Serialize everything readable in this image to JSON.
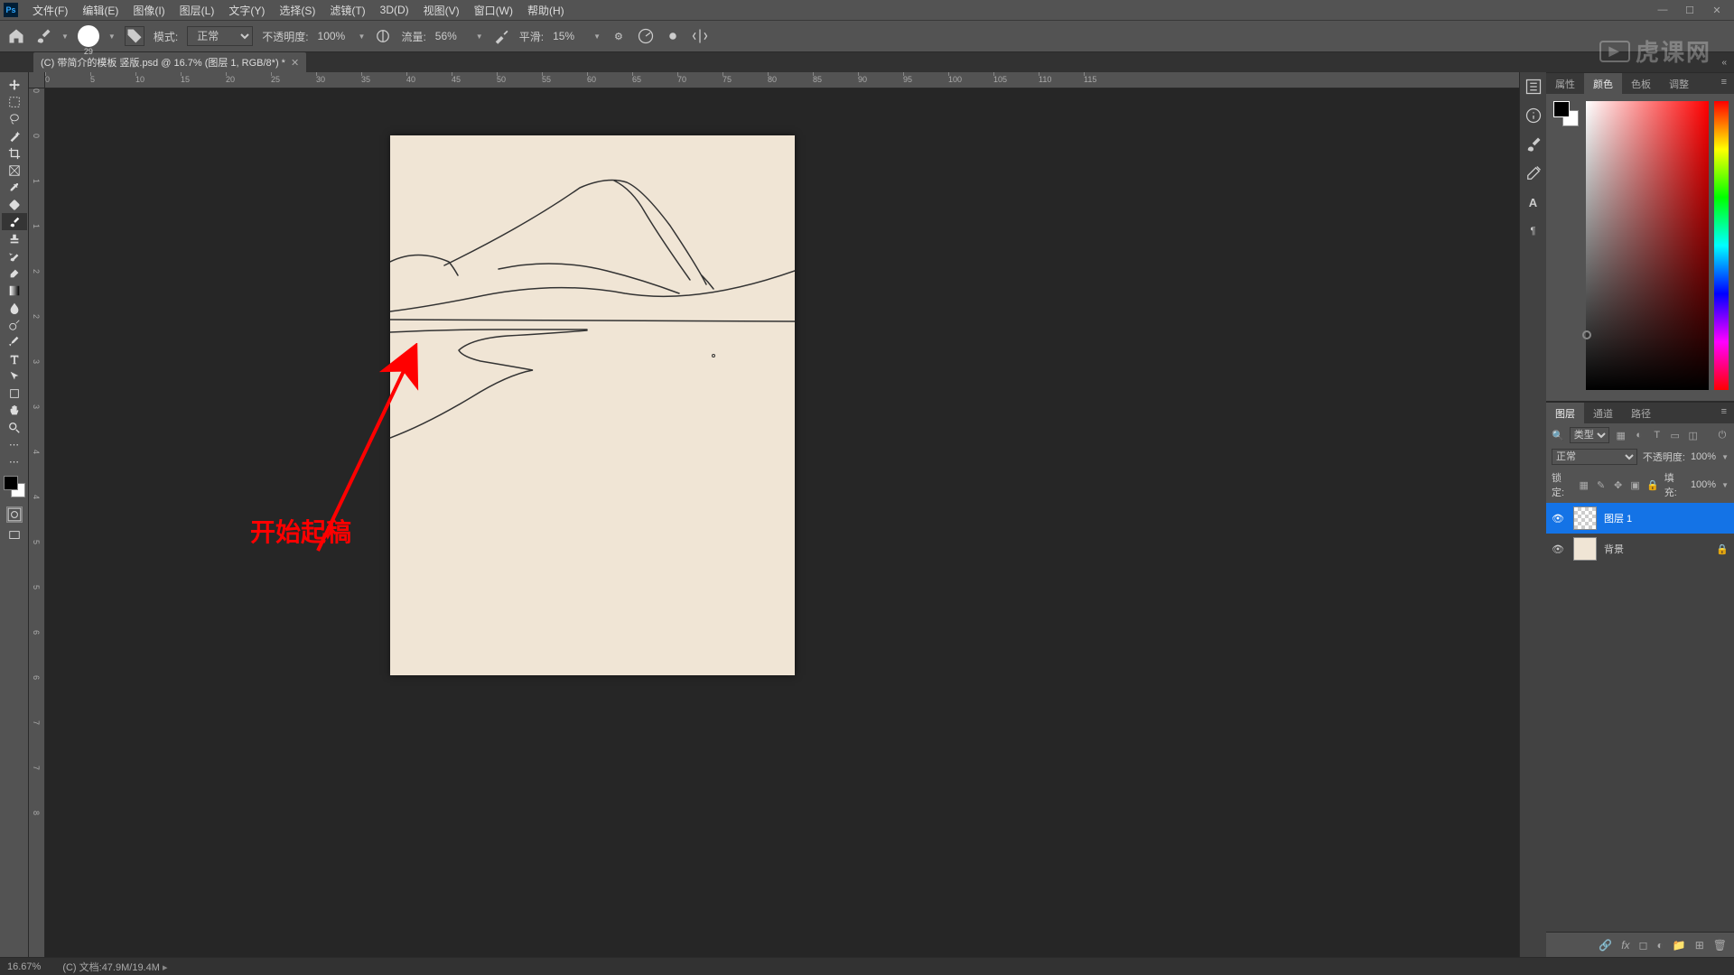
{
  "menubar": {
    "logo": "Ps",
    "items": [
      "文件(F)",
      "编辑(E)",
      "图像(I)",
      "图层(L)",
      "文字(Y)",
      "选择(S)",
      "滤镜(T)",
      "3D(D)",
      "视图(V)",
      "窗口(W)",
      "帮助(H)"
    ],
    "window_controls": [
      "—",
      "☐",
      "✕"
    ]
  },
  "options": {
    "brush_size": "29",
    "mode_label": "模式:",
    "mode_value": "正常",
    "opacity_label": "不透明度:",
    "opacity_value": "100%",
    "flow_label": "流量:",
    "flow_value": "56%",
    "smooth_label": "平滑:",
    "smooth_value": "15%"
  },
  "tab": {
    "title": "(C) 带简介的模板 竖版.psd @ 16.7% (图层 1, RGB/8*) *"
  },
  "ruler_h": [
    "0",
    "5",
    "10",
    "15",
    "20",
    "25",
    "30",
    "35",
    "40",
    "45",
    "50",
    "55",
    "60",
    "65",
    "70",
    "75",
    "80",
    "85",
    "90",
    "95",
    "100",
    "105",
    "110",
    "115"
  ],
  "ruler_v": [
    "0",
    "0",
    "1",
    "1",
    "2",
    "2",
    "3",
    "3",
    "4",
    "4",
    "5",
    "5",
    "6",
    "6",
    "7",
    "7",
    "8"
  ],
  "annotation": "开始起稿",
  "panels": {
    "color_group": [
      "属性",
      "颜色",
      "色板",
      "调整"
    ],
    "layer_group": [
      "图层",
      "通道",
      "路径"
    ]
  },
  "layers": {
    "filter_placeholder": "类型",
    "blend_mode": "正常",
    "opacity_label": "不透明度:",
    "opacity_value": "100%",
    "lock_label": "锁定:",
    "fill_label": "填充:",
    "fill_value": "100%",
    "items": [
      {
        "name": "图层 1",
        "locked": false,
        "selected": true,
        "thumb": "checker"
      },
      {
        "name": "背景",
        "locked": true,
        "selected": false,
        "thumb": "bg-col"
      }
    ]
  },
  "status": {
    "zoom": "16.67%",
    "doc_info": "(C) 文档:47.9M/19.4M"
  },
  "watermark": "虎课网",
  "icons": {
    "search": "🔍"
  }
}
